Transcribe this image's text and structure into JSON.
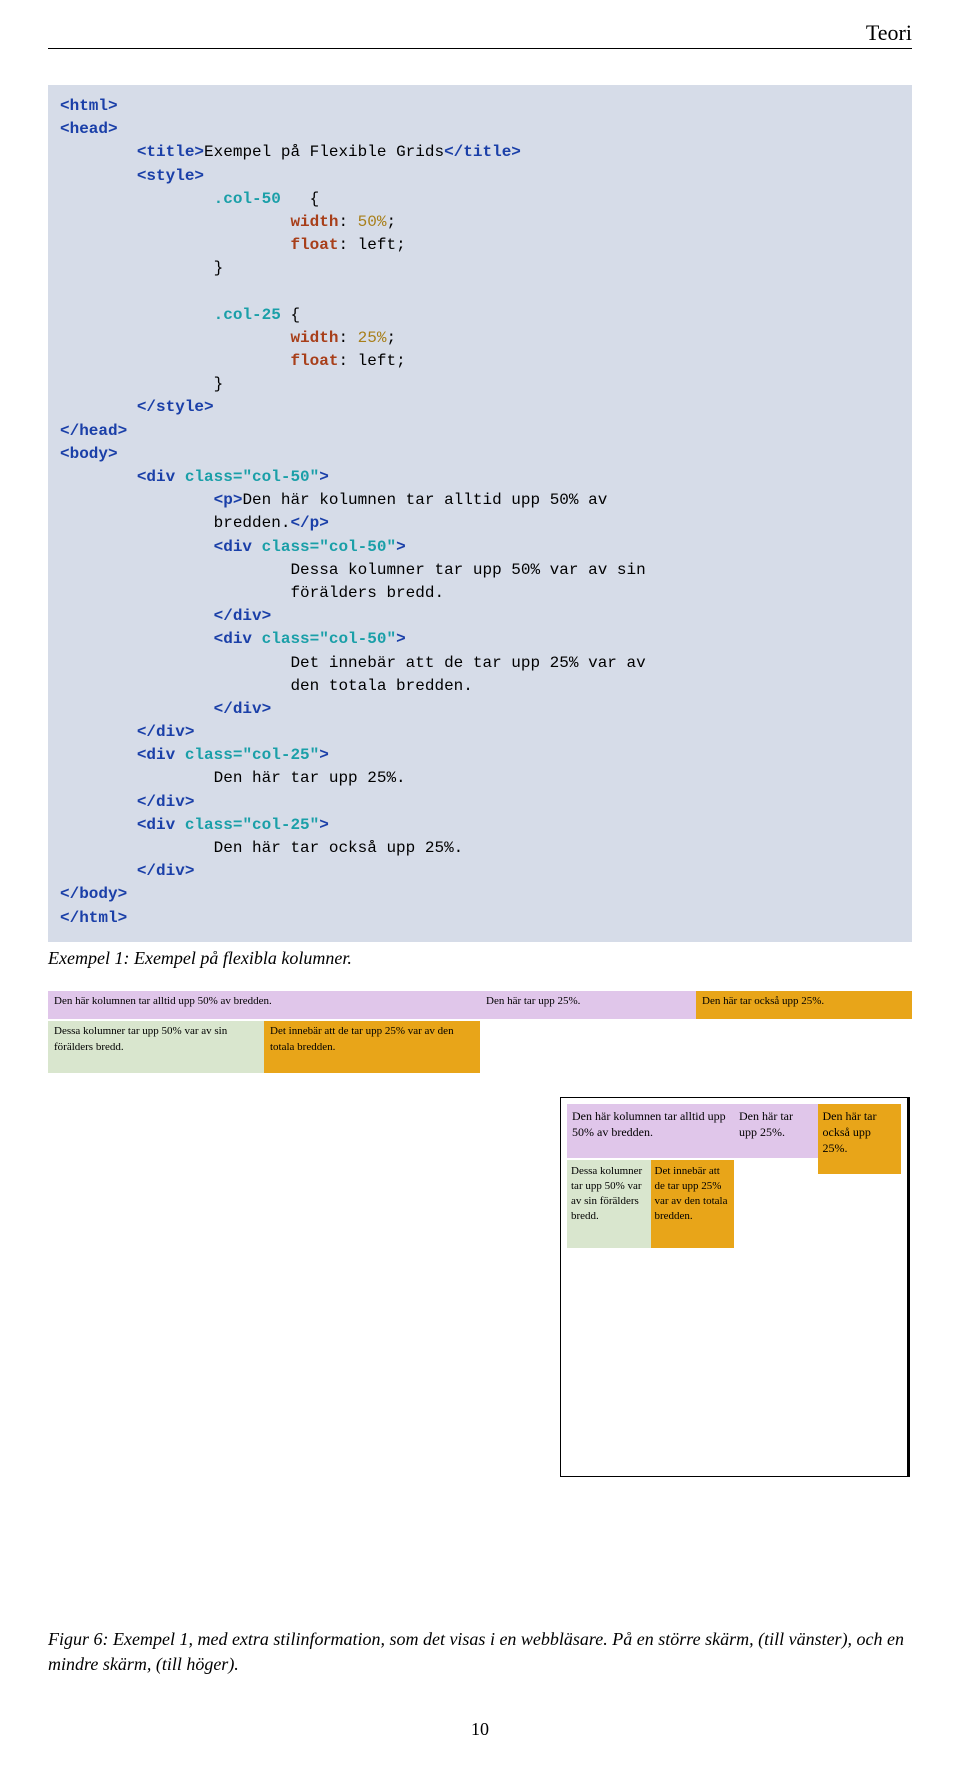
{
  "header": {
    "title": "Teori"
  },
  "code": {
    "l1a": "<html>",
    "l1b": "",
    "l2a": "<head>",
    "l2b": "",
    "l3a": "        ",
    "l3b": "<title>",
    "l3c": "Exempel på Flexible Grids",
    "l3d": "</title>",
    "l4a": "        ",
    "l4b": "<style>",
    "l5a": "                ",
    "l5b": ".col-50",
    "l5c": "   {",
    "l6a": "                        ",
    "l6b": "width",
    "l6c": ": ",
    "l6d": "50%",
    "l6e": ";",
    "l7a": "                        ",
    "l7b": "float",
    "l7c": ": left;",
    "l8a": "                }",
    "l9": "",
    "l10a": "                ",
    "l10b": ".col-25",
    "l10c": " {",
    "l11a": "                        ",
    "l11b": "width",
    "l11c": ": ",
    "l11d": "25%",
    "l11e": ";",
    "l12a": "                        ",
    "l12b": "float",
    "l12c": ": left;",
    "l13a": "                }",
    "l14a": "        ",
    "l14b": "</style>",
    "l15a": "</head>",
    "l16a": "<body>",
    "l17a": "        ",
    "l17b": "<div ",
    "l17c": "class=",
    "l17d": "\"col-50\"",
    "l17e": ">",
    "l18a": "                ",
    "l18b": "<p>",
    "l18c": "Den här kolumnen tar alltid upp 50% av",
    "l19a": "                bredden.",
    "l19b": "</p>",
    "l20a": "                ",
    "l20b": "<div ",
    "l20c": "class=",
    "l20d": "\"col-50\"",
    "l20e": ">",
    "l21a": "                        Dessa kolumner tar upp 50% var av sin",
    "l22a": "                        förälders bredd.",
    "l23a": "                ",
    "l23b": "</div>",
    "l24a": "                ",
    "l24b": "<div ",
    "l24c": "class=",
    "l24d": "\"col-50\"",
    "l24e": ">",
    "l25a": "                        Det innebär att de tar upp 25% var av",
    "l26a": "                        den totala bredden.",
    "l27a": "                ",
    "l27b": "</div>",
    "l28a": "        ",
    "l28b": "</div>",
    "l29a": "        ",
    "l29b": "<div ",
    "l29c": "class=",
    "l29d": "\"col-25\"",
    "l29e": ">",
    "l30a": "                Den här tar upp 25%.",
    "l31a": "        ",
    "l31b": "</div>",
    "l32a": "        ",
    "l32b": "<div ",
    "l32c": "class=",
    "l32d": "\"col-25\"",
    "l32e": ">",
    "l33a": "                Den här tar också upp 25%.",
    "l34a": "        ",
    "l34b": "</div>",
    "l35a": "</body>",
    "l36a": "</html>"
  },
  "caption1": "Exempel 1: Exempel på flexibla kolumner.",
  "demo": {
    "p50": "Den här kolumnen tar alltid upp 50% av bredden.",
    "p25a": "Den här tar upp 25%.",
    "p25b": "Den här tar också upp 25%.",
    "inner_a": "Dessa kolumner tar upp 50% var av sin förälders bredd.",
    "inner_b": "Det innebär att de tar upp 25% var av den totala bredden."
  },
  "caption2": "Figur 6: Exempel 1, med extra stilinformation, som det visas i en webbläsare. På en större skärm, (till vänster), och en mindre skärm, (till höger).",
  "page_number": "10"
}
